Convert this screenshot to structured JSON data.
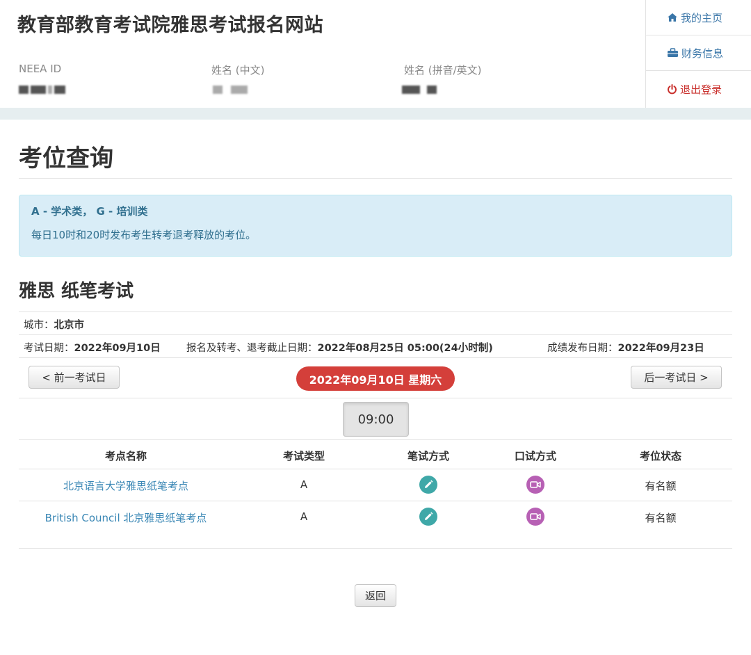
{
  "header": {
    "site_title": "教育部教育考试院雅思考试报名网站",
    "fields": [
      {
        "label": "NEEA ID"
      },
      {
        "label": "姓名 (中文)"
      },
      {
        "label": "姓名 (拼音/英文)"
      }
    ]
  },
  "side_nav": {
    "home": "我的主页",
    "finance": "财务信息",
    "logout": "退出登录"
  },
  "main": {
    "page_title": "考位查询",
    "alert": {
      "line1": "A - 学术类， G - 培训类",
      "line2": "每日10时和20时发布考生转考退考释放的考位。"
    },
    "section_title": "雅思 纸笔考试",
    "city_label": "城市：",
    "city_value": "北京市",
    "exam_date_label": "考试日期：",
    "exam_date_value": "2022年09月10日",
    "deadline_label": "报名及转考、退考截止日期：",
    "deadline_value": "2022年08月25日 05:00(24小时制)",
    "result_date_label": "成绩发布日期：",
    "result_date_value": "2022年09月23日",
    "prev_button": "< 前一考试日",
    "next_button": "后一考试日 >",
    "current_date": "2022年09月10日 星期六",
    "time_slot": "09:00",
    "table": {
      "headers": [
        "考点名称",
        "考试类型",
        "笔试方式",
        "口试方式",
        "考位状态"
      ],
      "rows": [
        {
          "name": "北京语言大学雅思纸笔考点",
          "type": "A",
          "written_icon": "pencil-icon",
          "oral_icon": "video-icon",
          "status": "有名额"
        },
        {
          "name": "British Council 北京雅思纸笔考点",
          "type": "A",
          "written_icon": "pencil-icon",
          "oral_icon": "video-icon",
          "status": "有名额"
        }
      ]
    },
    "back_button": "返回"
  },
  "colors": {
    "link": "#3a87b5",
    "alert_bg": "#d9edf7",
    "alert_text": "#31708f",
    "date_pill": "#d43f3a",
    "pen_icon": "#3fa8a8",
    "video_icon": "#b760b4",
    "logout": "#c9302c"
  }
}
